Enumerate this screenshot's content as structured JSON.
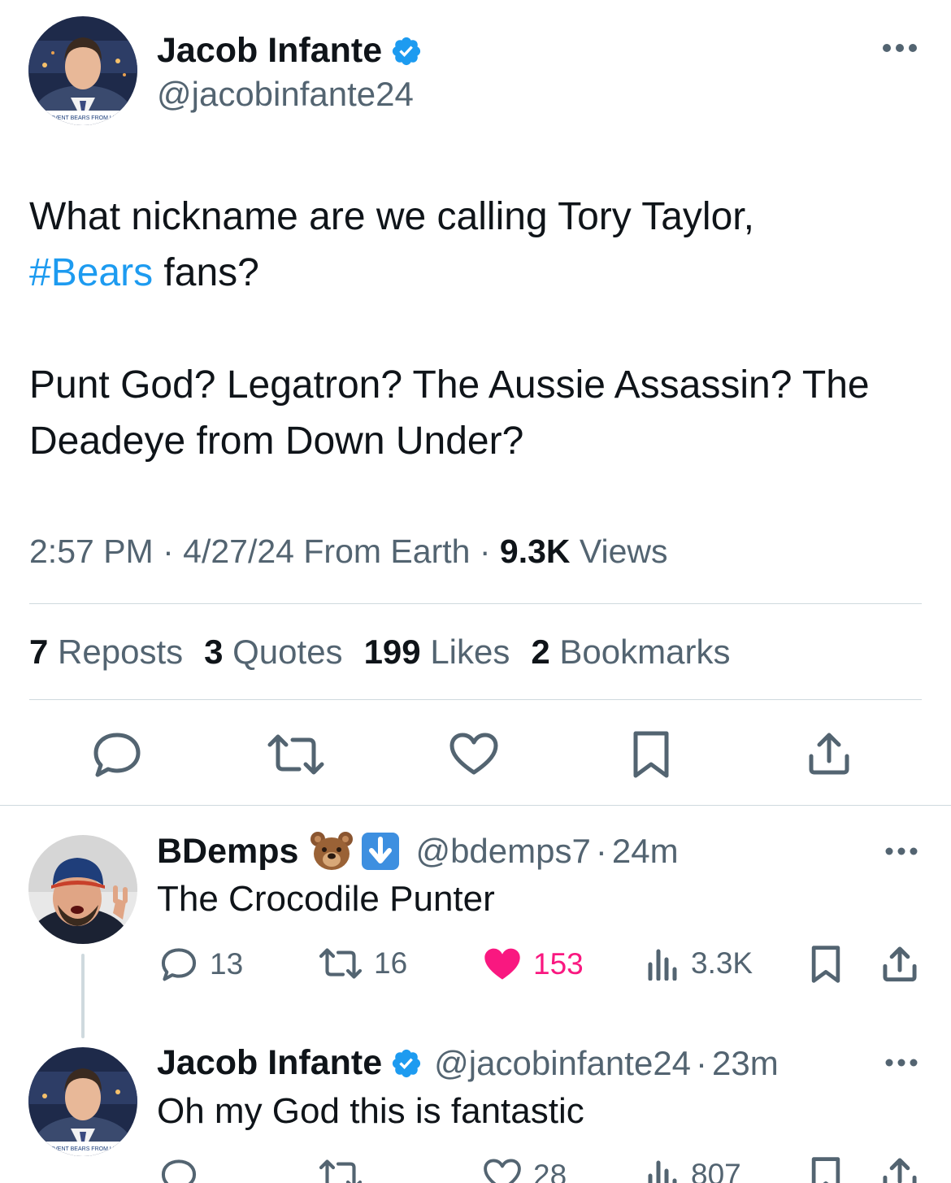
{
  "main_tweet": {
    "author_name": "Jacob Infante",
    "handle": "@jacobinfante24",
    "text_line1": "What nickname are we calling Tory Taylor,",
    "hashtag": "#Bears",
    "text_line2_rest": " fans?",
    "text_para2": "Punt God? Legatron? The Aussie Assassin? The Deadeye from Down Under?",
    "time": "2:57 PM",
    "date": "4/27/24",
    "source": "From Earth",
    "views_count": "9.3K",
    "views_label": "Views",
    "reposts_count": "7",
    "reposts_label": "Reposts",
    "quotes_count": "3",
    "quotes_label": "Quotes",
    "likes_count": "199",
    "likes_label": "Likes",
    "bookmarks_count": "2",
    "bookmarks_label": "Bookmarks",
    "avatar_caption": "PREVENT BEARS FROM LEAV"
  },
  "replies": [
    {
      "author_name": "BDemps",
      "handle": "@bdemps7",
      "time": "24m",
      "text": "The Crocodile Punter",
      "reply_count": "13",
      "repost_count": "16",
      "like_count": "153",
      "view_count": "3.3K",
      "liked": true
    },
    {
      "author_name": "Jacob Infante",
      "handle": "@jacobinfante24",
      "time": "23m",
      "text": "Oh my God this is fantastic",
      "reply_count": "",
      "repost_count": "",
      "like_count": "28",
      "view_count": "807",
      "liked": false
    }
  ],
  "separator": "·",
  "colors": {
    "accent": "#1d9bf0",
    "muted": "#536471",
    "like": "#f91880",
    "divider": "#cfd9de"
  },
  "icons": [
    "verified-badge-icon",
    "more-icon",
    "reply-icon",
    "repost-icon",
    "like-icon",
    "bookmark-icon",
    "share-icon",
    "views-icon",
    "bear-emoji-icon",
    "down-arrow-emoji-icon"
  ]
}
